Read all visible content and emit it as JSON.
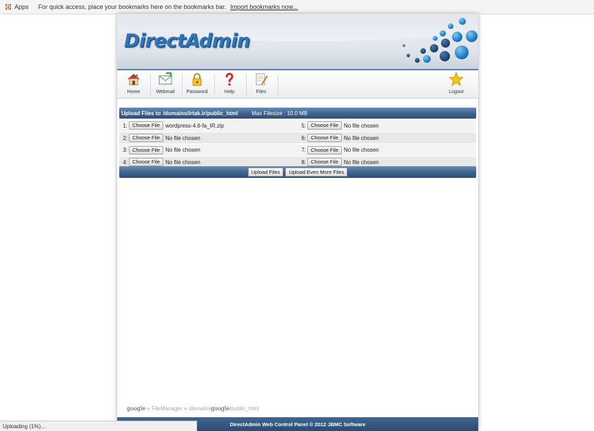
{
  "bookmarks_bar": {
    "apps_label": "Apps",
    "message": "For quick access, place your bookmarks here on the bookmarks bar.",
    "import_link": "Import bookmarks now..."
  },
  "header": {
    "logo_text": "DirectAdmin"
  },
  "nav": {
    "items": [
      {
        "label": "Home",
        "icon": "home-icon"
      },
      {
        "label": "Webmail",
        "icon": "webmail-icon"
      },
      {
        "label": "Password",
        "icon": "lock-icon"
      },
      {
        "label": "Help",
        "icon": "help-icon"
      },
      {
        "label": "Files",
        "icon": "files-icon"
      },
      {
        "label": "Logout",
        "icon": "star-icon"
      }
    ]
  },
  "upload": {
    "title": "Upload Files to",
    "path": "/domains/irtak.ir/public_html",
    "max_filesize": "Max Filesize : 10.0 MB",
    "choose_label": "Choose File",
    "slots": [
      {
        "index": "1:",
        "file": "wordpress-4.6-fa_IR.zip"
      },
      {
        "index": "5:",
        "file": "No file chosen"
      },
      {
        "index": "2:",
        "file": "No file chosen"
      },
      {
        "index": "6:",
        "file": "No file chosen"
      },
      {
        "index": "3:",
        "file": "No file chosen"
      },
      {
        "index": "7:",
        "file": "No file chosen"
      },
      {
        "index": "4:",
        "file": "No file chosen"
      },
      {
        "index": "8:",
        "file": "No file chosen"
      }
    ],
    "upload_button": "Upload Files",
    "upload_more_button": "Upload Even More Files"
  },
  "breadcrumb": {
    "root": "google",
    "sep1": " » ",
    "file_manager": "FileManager",
    "sep2": " » ",
    "domains": "/domains",
    "middle": "google",
    "tail": "/public_html"
  },
  "footer": {
    "text": "DirectAdmin Web Control Panel © 2012 JBMC Software"
  },
  "status": {
    "text": "Uploading (1%)..."
  },
  "colors": {
    "accent": "#2f75b8",
    "bar": "#3c618d"
  }
}
